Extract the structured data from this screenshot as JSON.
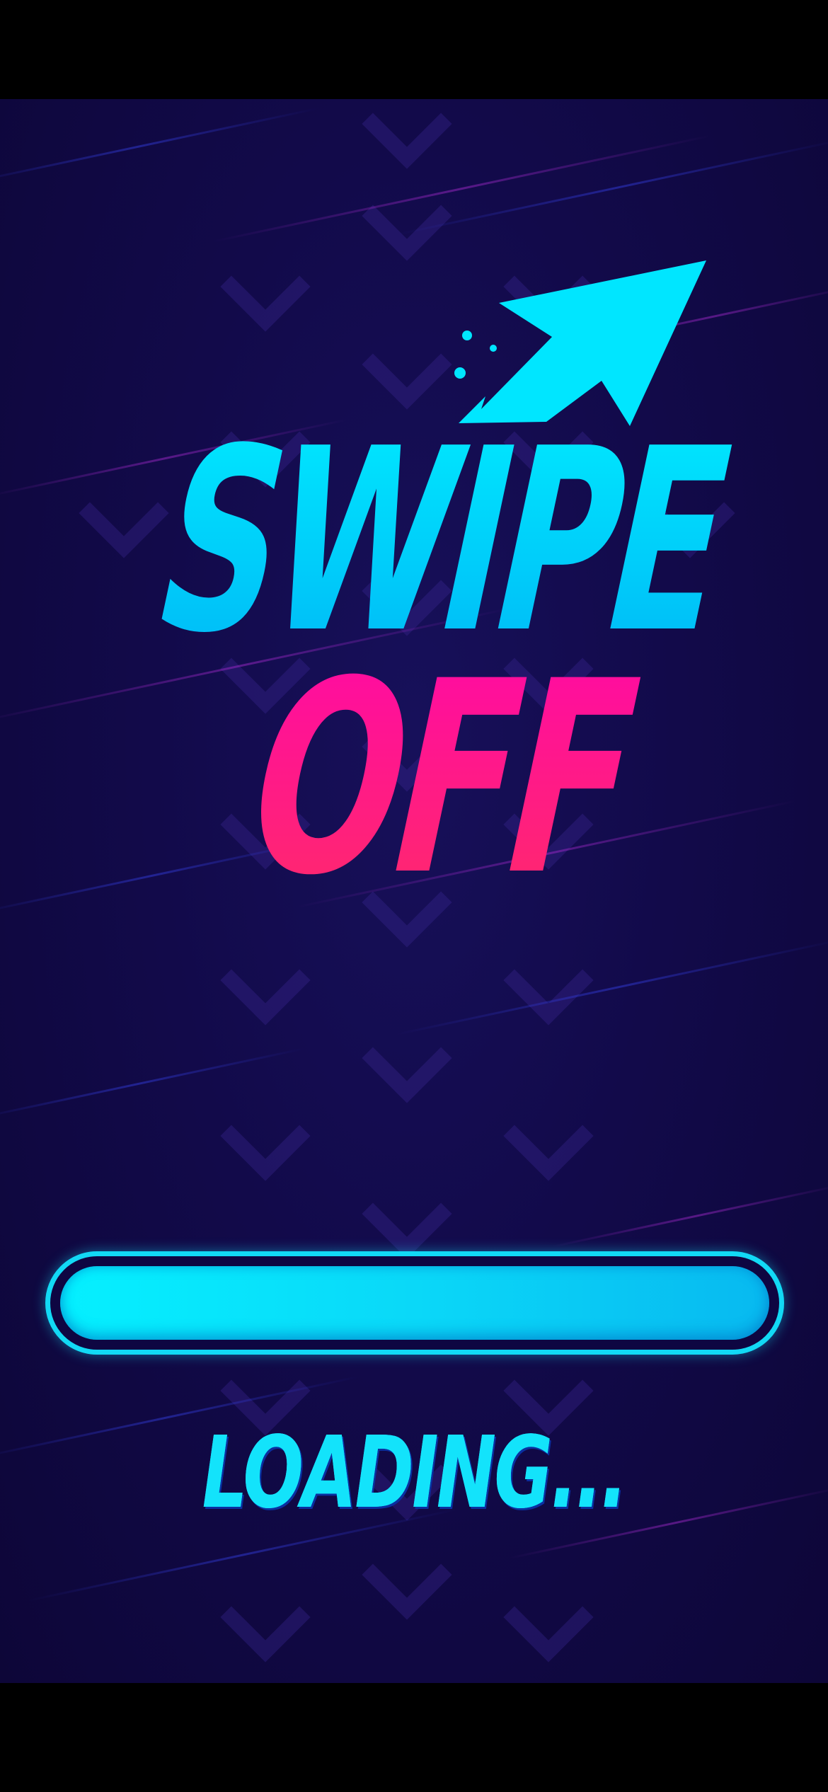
{
  "game": {
    "title_line1": "SWIPE",
    "title_line2": "OFF",
    "loading_label": "LOADING...",
    "loading_progress": 1.0,
    "icons": {
      "logo_arrow": "arrow-up-right-icon"
    },
    "colors": {
      "background": "#120a4a",
      "letterbox": "#000000",
      "title_cyan_top": "#00e7ff",
      "title_cyan_bottom": "#00b8f5",
      "title_pink_top": "#ff0aa0",
      "title_pink_bottom": "#ff2a6a",
      "bar_border": "#12d9f5",
      "bar_fill": "#05f0ff",
      "loading_text": "#13e3fb"
    }
  }
}
